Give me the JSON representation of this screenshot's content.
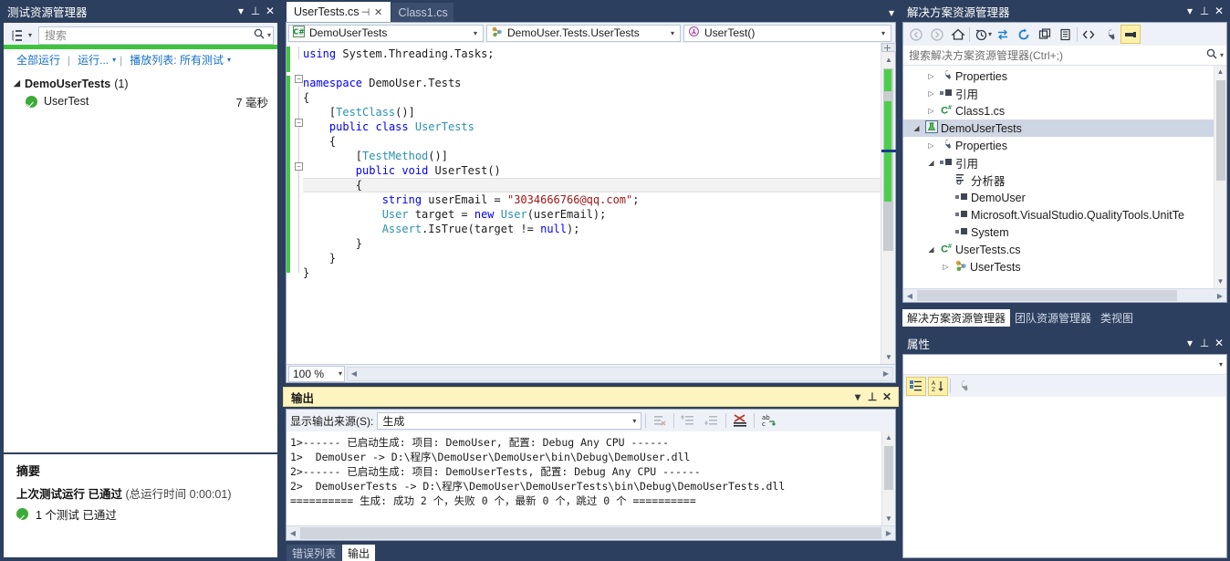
{
  "test_explorer": {
    "title": "测试资源管理器",
    "search_placeholder": "搜索",
    "group_icon": "group-by-icon",
    "search_icon": "search-icon",
    "toolbar": {
      "run_all": "全部运行",
      "run": "运行...",
      "playlist": "播放列表: 所有测试"
    },
    "group": {
      "name": "DemoUserTests",
      "count": "(1)"
    },
    "tests": [
      {
        "name": "UserTest",
        "duration": "7 毫秒",
        "status": "passed"
      }
    ],
    "summary": {
      "heading": "摘要",
      "line1_a": "上次测试运行",
      "line1_b": "已通过",
      "line1_c": "(总运行时间 0:00:01)",
      "line2": "1 个测试 已通过"
    }
  },
  "editor": {
    "tabs": [
      {
        "label": "UserTests.cs",
        "active": true
      },
      {
        "label": "Class1.cs",
        "active": false
      }
    ],
    "pin_icon": "pin-icon",
    "close_icon": "close-icon",
    "navbar": {
      "project": "DemoUserTests",
      "project_icon": "csharp-project-icon",
      "type": "DemoUser.Tests.UserTests",
      "type_icon": "class-icon",
      "member": "UserTest()",
      "member_icon": "method-icon"
    },
    "zoom": "100 %",
    "code_lines": [
      "using System.Threading.Tasks;",
      "",
      "namespace DemoUser.Tests",
      "{",
      "    [TestClass()]",
      "    public class UserTests",
      "    {",
      "        [TestMethod()]",
      "        public void UserTest()",
      "        {",
      "            string userEmail = \"3034666766@qq.com\";",
      "            User target = new User(userEmail);",
      "            Assert.IsTrue(target != null);",
      "        }",
      "    }",
      "}"
    ]
  },
  "output": {
    "title": "输出",
    "source_label": "显示输出来源(S):",
    "source_value": "生成",
    "toolbar_icons": [
      "clear-all-icon",
      "go-to-previous-message-icon",
      "go-to-next-message-icon",
      "toggle-word-wrap-icon",
      "find-in-output-icon"
    ],
    "lines": [
      "1>------ 已启动生成: 项目: DemoUser, 配置: Debug Any CPU ------",
      "1>  DemoUser -> D:\\程序\\DemoUser\\DemoUser\\bin\\Debug\\DemoUser.dll",
      "2>------ 已启动生成: 项目: DemoUserTests, 配置: Debug Any CPU ------",
      "2>  DemoUserTests -> D:\\程序\\DemoUser\\DemoUserTests\\bin\\Debug\\DemoUserTests.dll",
      "========== 生成: 成功 2 个，失败 0 个，最新 0 个，跳过 0 个 =========="
    ],
    "bottom_tabs": [
      {
        "label": "错误列表",
        "active": false
      },
      {
        "label": "输出",
        "active": true
      }
    ]
  },
  "solution_explorer": {
    "title": "解决方案资源管理器",
    "search_placeholder": "搜索解决方案资源管理器(Ctrl+;)",
    "toolbar_icons": [
      "back-icon",
      "forward-icon",
      "home-icon",
      "pending-changes-icon",
      "sync-with-active-document-icon",
      "refresh-icon",
      "collapse-all-icon",
      "show-all-files-icon",
      "view-code-icon",
      "properties-icon",
      "preview-selected-items-icon"
    ],
    "tree": [
      {
        "label": "Properties",
        "icon": "wrench-icon",
        "indent": 1,
        "twist": "collapsed",
        "selected": false
      },
      {
        "label": "引用",
        "icon": "references-icon",
        "indent": 1,
        "twist": "collapsed",
        "selected": false
      },
      {
        "label": "Class1.cs",
        "icon": "csharp-file-icon",
        "indent": 1,
        "twist": "collapsed",
        "selected": false
      },
      {
        "label": "DemoUserTests",
        "icon": "test-project-icon",
        "indent": 0,
        "twist": "expanded",
        "selected": true
      },
      {
        "label": "Properties",
        "icon": "wrench-icon",
        "indent": 1,
        "twist": "collapsed",
        "selected": false
      },
      {
        "label": "引用",
        "icon": "references-icon",
        "indent": 1,
        "twist": "expanded",
        "selected": false
      },
      {
        "label": "分析器",
        "icon": "analyzers-icon",
        "indent": 2,
        "twist": "none",
        "selected": false
      },
      {
        "label": "DemoUser",
        "icon": "reference-icon",
        "indent": 2,
        "twist": "none",
        "selected": false
      },
      {
        "label": "Microsoft.VisualStudio.QualityTools.UnitTe",
        "icon": "reference-icon",
        "indent": 2,
        "twist": "none",
        "selected": false
      },
      {
        "label": "System",
        "icon": "reference-icon",
        "indent": 2,
        "twist": "none",
        "selected": false
      },
      {
        "label": "UserTests.cs",
        "icon": "csharp-file-icon",
        "indent": 1,
        "twist": "expanded",
        "selected": false
      },
      {
        "label": "UserTests",
        "icon": "class-icon",
        "indent": 2,
        "twist": "collapsed",
        "selected": false
      }
    ],
    "tabs": [
      {
        "label": "解决方案资源管理器",
        "active": true
      },
      {
        "label": "团队资源管理器",
        "active": false
      },
      {
        "label": "类视图",
        "active": false
      }
    ]
  },
  "properties_panel": {
    "title": "属性",
    "object_value": "",
    "toolbar_icons": [
      "categorized-icon",
      "alphabetical-icon",
      "property-pages-icon"
    ]
  },
  "window_controls": {
    "dropdown_icon": "chevron-down-icon",
    "pin_icon": "pin-icon",
    "close_icon": "close-icon"
  },
  "colors": {
    "chrome": "#2d3f5e",
    "accent_green": "#3fc33f",
    "output_header": "#fdf4bf",
    "selection": "#cfd6e3"
  }
}
